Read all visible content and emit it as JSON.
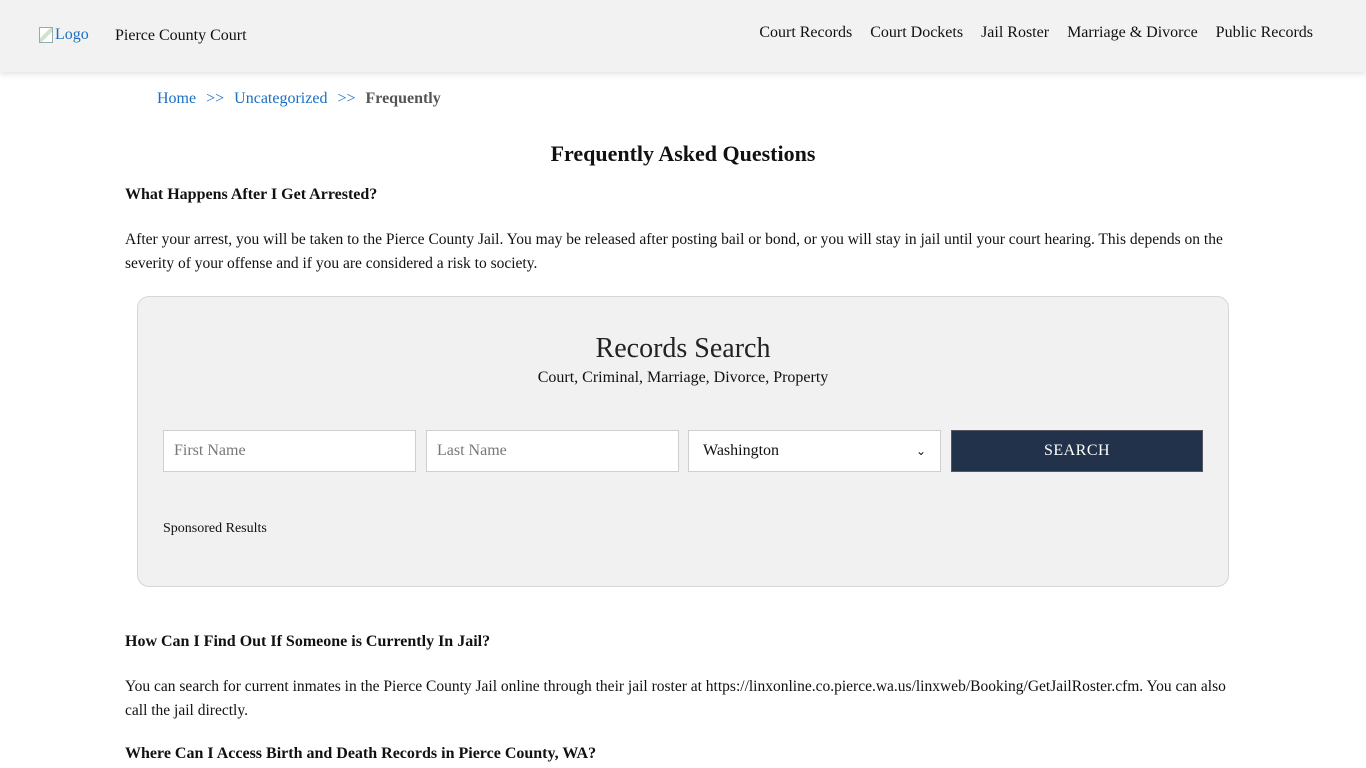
{
  "header": {
    "logo_alt": "Logo",
    "site_title": "Pierce County Court",
    "nav": [
      "Court Records",
      "Court Dockets",
      "Jail Roster",
      "Marriage & Divorce",
      "Public Records"
    ]
  },
  "breadcrumb": {
    "home": "Home",
    "separator": ">>",
    "category": "Uncategorized",
    "current": "Frequently"
  },
  "page_title": "Frequently Asked Questions",
  "faq": [
    {
      "question": "What Happens After I Get Arrested?",
      "answer": "After your arrest, you will be taken to the Pierce County Jail. You may be released after posting bail or bond, or you will stay in jail until your court hearing. This depends on the severity of your offense and if you are considered a risk to society."
    },
    {
      "question": "How Can I Find Out If Someone is Currently In Jail?",
      "answer": "You can search for current inmates in the Pierce County Jail online through their jail roster at https://linxonline.co.pierce.wa.us/linxweb/Booking/GetJailRoster.cfm. You can also call the jail directly."
    },
    {
      "question": "Where Can I Access Birth and Death Records in Pierce County, WA?",
      "answer": ""
    }
  ],
  "search": {
    "title": "Records Search",
    "subtitle": "Court, Criminal, Marriage, Divorce, Property",
    "first_name_placeholder": "First Name",
    "last_name_placeholder": "Last Name",
    "state_selected": "Washington",
    "button_label": "SEARCH",
    "sponsored": "Sponsored Results"
  },
  "colors": {
    "link": "#1a6fc4",
    "search_button": "#22324a",
    "header_bg": "#f2f2f2"
  }
}
